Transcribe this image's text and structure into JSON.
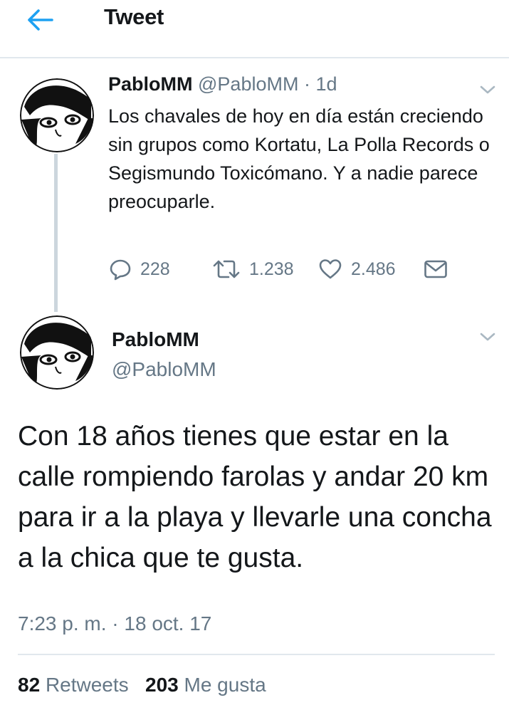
{
  "header": {
    "title": "Tweet",
    "back_icon": "arrow-left-icon",
    "accent_color": "#1da1f2"
  },
  "parent_tweet": {
    "name": "PabloMM",
    "handle": "@PabloMM",
    "separator": "·",
    "age": "1d",
    "text": "Los chavales de hoy en día están creciendo sin grupos como Kortatu, La Polla Records o Segismundo Toxicómano. Y a nadie parece preocuparle.",
    "replies": "228",
    "retweets": "1.238",
    "likes": "2.486"
  },
  "main_tweet": {
    "name": "PabloMM",
    "handle": "@PabloMM",
    "text": "Con 18 años tienes que estar en la calle rompiendo farolas y andar 20 km para ir a la playa y llevarle una concha a la chica que te gusta.",
    "timestamp": "7:23 p. m. · 18 oct. 17"
  },
  "stats": {
    "retweets_count": "82",
    "retweets_label": "Retweets",
    "likes_count": "203",
    "likes_label": "Me gusta"
  }
}
